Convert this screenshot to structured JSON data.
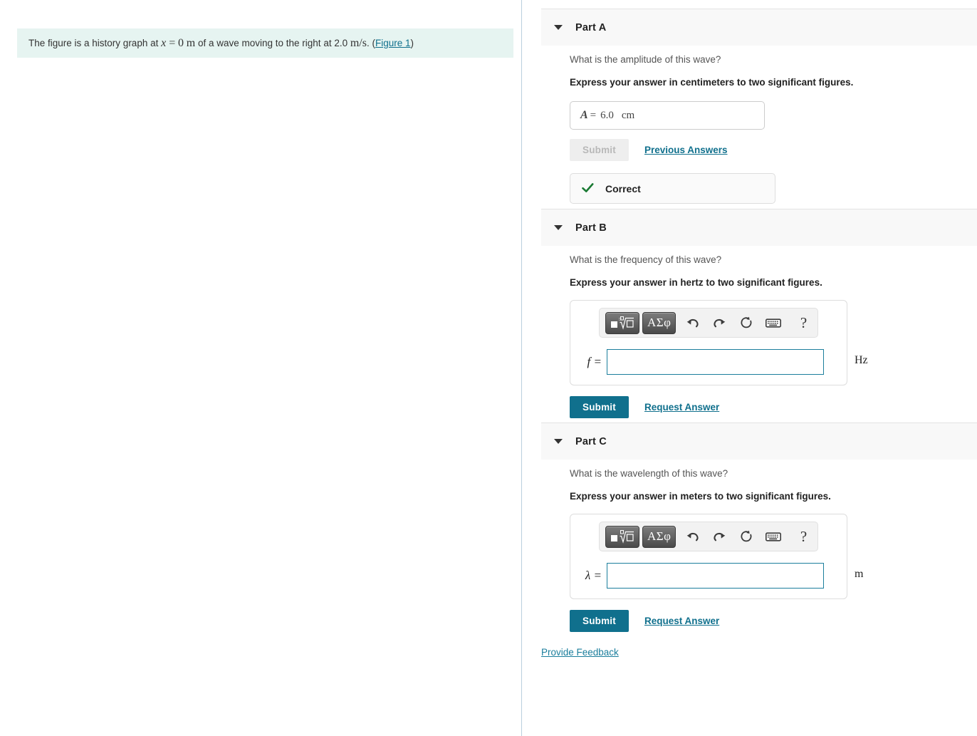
{
  "problem": {
    "text_before_x": "The figure is a history graph at",
    "var_x": "x",
    "equals": "=",
    "value_x": "0",
    "unit_x": "m",
    "text_middle": "of a wave moving to the right at 2.0",
    "unit_speed": "m/s",
    "text_after": ".",
    "figure_link": "Figure 1",
    "paren_open": "(",
    "paren_close": ")"
  },
  "parts": [
    {
      "id": "part-a",
      "title": "Part A",
      "question": "What is the amplitude of this wave?",
      "instruction": "Express your answer in centimeters to two significant figures.",
      "state": "answered",
      "answer": {
        "variable": "A",
        "equals": "=",
        "value": "6.0",
        "unit": "cm"
      },
      "submit_label": "Submit",
      "submit_disabled": true,
      "secondary_link": "Previous Answers",
      "feedback": {
        "icon": "check-icon",
        "label": "Correct"
      }
    },
    {
      "id": "part-b",
      "title": "Part B",
      "question": "What is the frequency of this wave?",
      "instruction": "Express your answer in hertz to two significant figures.",
      "state": "open",
      "entry": {
        "variable": "f =",
        "value": "",
        "placeholder": "",
        "unit": "Hz"
      },
      "submit_label": "Submit",
      "submit_disabled": false,
      "secondary_link": "Request Answer"
    },
    {
      "id": "part-c",
      "title": "Part C",
      "question": "What is the wavelength of this wave?",
      "instruction": "Express your answer in meters to two significant figures.",
      "state": "open",
      "entry": {
        "variable": "λ =",
        "value": "",
        "placeholder": "",
        "unit": "m"
      },
      "submit_label": "Submit",
      "submit_disabled": false,
      "secondary_link": "Request Answer"
    }
  ],
  "math_toolbar": {
    "buttons": [
      {
        "name": "template-sqrt-button",
        "label": ""
      },
      {
        "name": "greek-symbols-button",
        "label": "ΑΣφ"
      }
    ],
    "icons": [
      {
        "name": "undo-icon",
        "glyph": "↶"
      },
      {
        "name": "redo-icon",
        "glyph": "↷"
      },
      {
        "name": "reset-icon",
        "glyph": "↺"
      },
      {
        "name": "keyboard-icon",
        "glyph": "⌨"
      },
      {
        "name": "help-icon",
        "glyph": "?"
      }
    ]
  },
  "footer": {
    "feedback_link": "Provide Feedback"
  },
  "colors": {
    "accent_teal": "#10708d",
    "link_teal": "#1b7e9c",
    "statement_bg": "#e6f4f1",
    "part_header_bg": "#f8f8f8",
    "correct_green": "#1a7a33"
  }
}
